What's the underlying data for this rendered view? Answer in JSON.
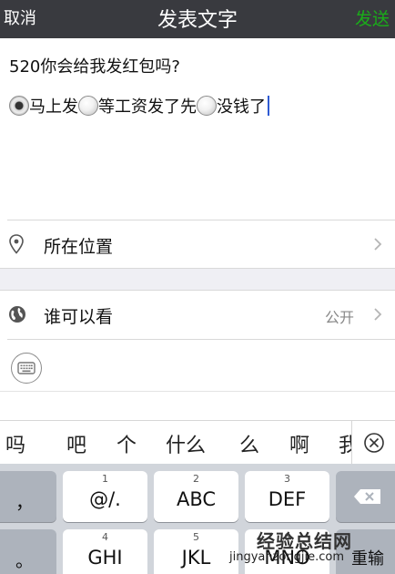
{
  "nav": {
    "cancel_label": "取消",
    "title": "发表文字",
    "send_label": "发送",
    "send_color": "#1aad19"
  },
  "post": {
    "question": "520你会给我发红包吗?",
    "options": [
      "马上发",
      "等工资发了先",
      "没钱了"
    ],
    "selected_option": 0
  },
  "rows": {
    "location": {
      "label": "所在位置",
      "icon": "location-pin-icon"
    },
    "visibility": {
      "label": "谁可以看",
      "value": "公开",
      "icon": "globe-icon"
    }
  },
  "toolbar": {
    "keyboard_icon": "keyboard-icon"
  },
  "candidates": [
    "吗",
    "吧",
    "个",
    "什么",
    "么",
    "啊",
    "我"
  ],
  "keyboard": {
    "side_left": [
      "，",
      "。"
    ],
    "keys": [
      {
        "num": "1",
        "label": "@/."
      },
      {
        "num": "2",
        "label": "ABC"
      },
      {
        "num": "3",
        "label": "DEF"
      },
      {
        "num": "4",
        "label": "GHI"
      },
      {
        "num": "5",
        "label": "JKL"
      },
      {
        "num": "6",
        "label": "MNO"
      }
    ],
    "backspace_icon": "backspace-icon",
    "side_right_partial": "重输"
  },
  "watermark": {
    "cn": "经验总结网",
    "en": "jingyanzongjie.com"
  }
}
